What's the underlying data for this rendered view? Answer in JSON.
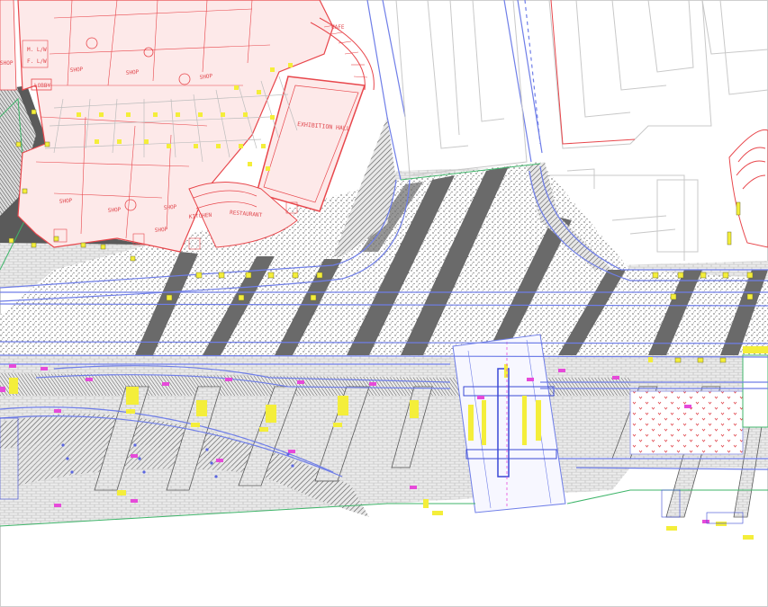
{
  "drawing": {
    "colors": {
      "background": "#ffffff",
      "building_outline": "#e8474c",
      "building_fill": "#fde9e9",
      "road_outline": "#6f7ee8",
      "paving_dark": "#5a5a5a",
      "paving_light": "#bdbdbd",
      "marker_yellow": "#f4ee3a",
      "marker_magenta": "#e64ad9",
      "kerb_green": "#3fb56a",
      "neighbour_lines": "#c8c8c8"
    },
    "room_labels": {
      "shop_1": "SHOP",
      "shop_2": "SHOP",
      "shop_3": "SHOP",
      "shop_4": "SHOP",
      "shop_5": "SHOP",
      "shop_6": "SHOP",
      "exhibition_hall": "EXHIBITION HALL",
      "cafe": "CAFE",
      "kitchen": "KITCHEN",
      "restaurant": "RESTAURANT",
      "lobby": "LOBBY",
      "wc_m": "M. L/W",
      "wc_f": "F. L/W",
      "shop_partial": "SHOP",
      "shop_left": "SHOP"
    }
  }
}
